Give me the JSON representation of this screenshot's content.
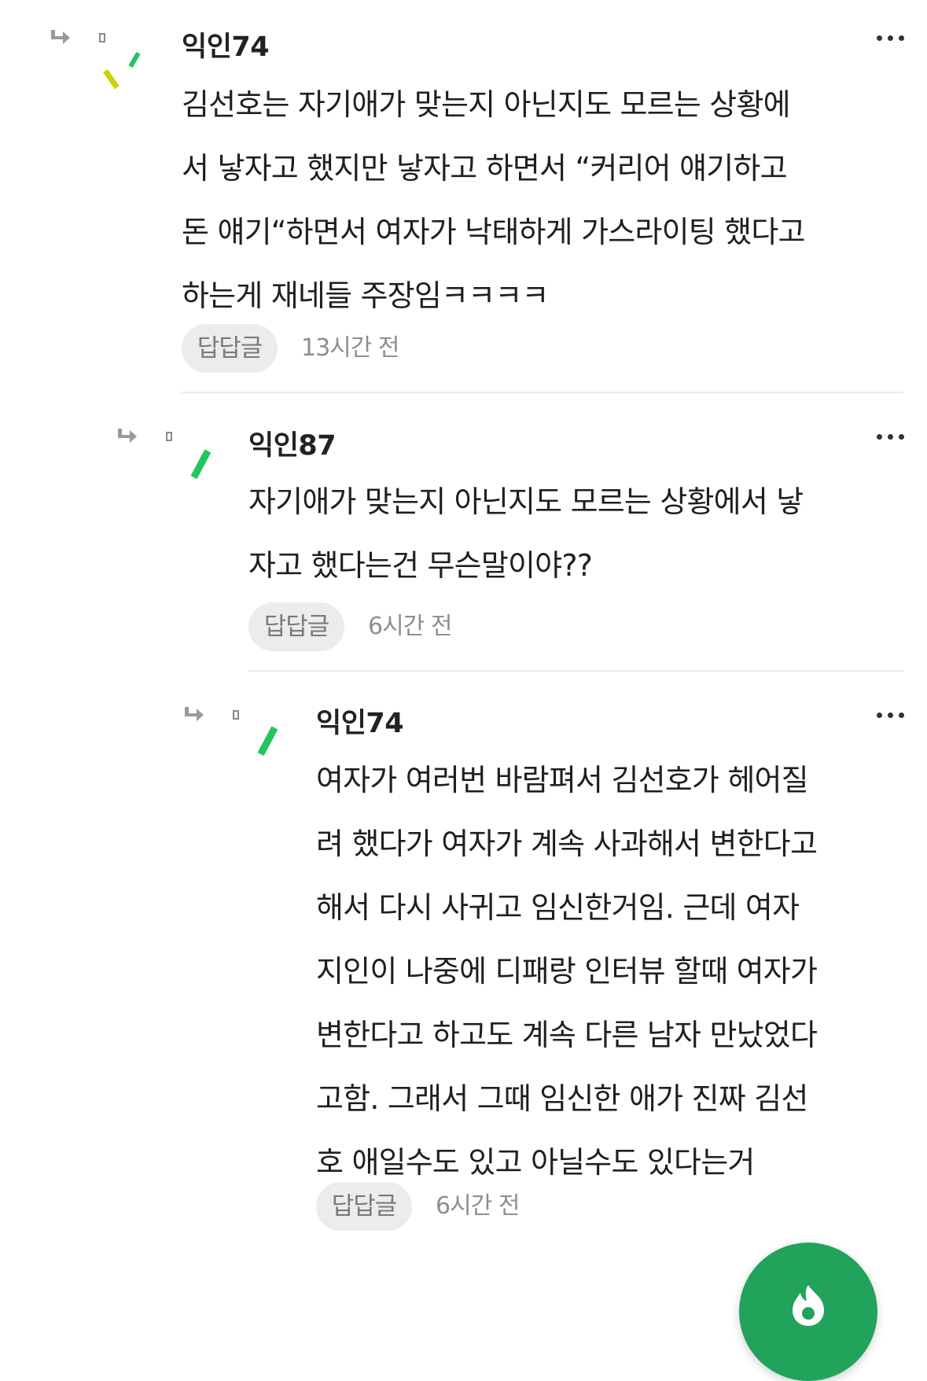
{
  "comments": [
    {
      "author": "익인74",
      "lines": [
        "김선호는 자기애가 맞는지 아닌지도 모르는 상황에",
        "서 낳자고 했지만 낳자고 하면서 “커리어 얘기하고",
        "돈 얘기“하면서 여자가 낙태하게 가스라이팅 했다고",
        "하는게 재네들 주장임ㅋㅋㅋㅋ"
      ],
      "reply_label": "답답글",
      "time": "13시간 전"
    },
    {
      "author": "익인87",
      "lines": [
        "자기애가 맞는지 아닌지도 모르는 상황에서 낳",
        "자고 했다는건 무슨말이야??"
      ],
      "reply_label": "답답글",
      "time": "6시간 전"
    },
    {
      "author": "익인74",
      "lines": [
        "여자가 여러번 바람펴서 김선호가 헤어질",
        "려 했다가 여자가 계속 사과해서 변한다고",
        "해서 다시 사귀고 임신한거임. 근데 여자",
        "지인이 나중에 디패랑 인터뷰 할때 여자가",
        "변한다고 하고도 계속 다른 남자 만났었다",
        "고함. 그래서 그때 임신한 애가 진짜 김선",
        "호 애일수도 있고 아닐수도 있다는거"
      ],
      "reply_label": "답답글",
      "time": "6시간 전"
    }
  ],
  "icons": {
    "reply": "reply-arrow-icon",
    "more": "more-icon",
    "fab": "flame-icon"
  },
  "colors": {
    "accent": "#21a35b",
    "avatar_green": "#22c55e",
    "avatar_yellow": "#c8d400"
  }
}
